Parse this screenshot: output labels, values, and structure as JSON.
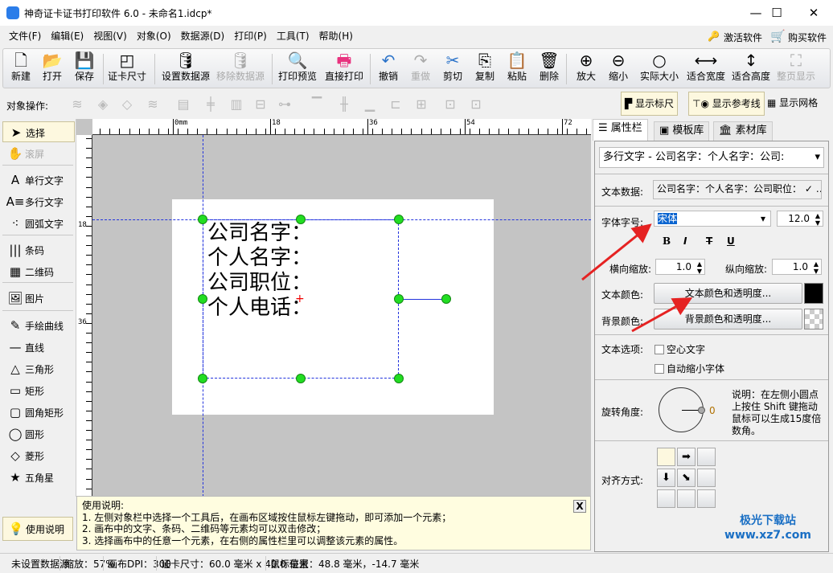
{
  "window": {
    "title": "神奇证卡证书打印软件 6.0 - 未命名1.idcp*",
    "minimize": "—",
    "maximize": "☐",
    "close": "✕"
  },
  "menu": [
    "文件(F)",
    "编辑(E)",
    "视图(V)",
    "对象(O)",
    "数据源(D)",
    "打印(P)",
    "工具(T)",
    "帮助(H)"
  ],
  "menu_right": {
    "activate": "激活软件",
    "buy": "购买软件"
  },
  "toolbar": [
    {
      "label": "新建",
      "icon": "new-file-icon",
      "glyph": "🗋"
    },
    {
      "label": "打开",
      "icon": "open-icon",
      "glyph": "📂"
    },
    {
      "label": "保存",
      "icon": "save-icon",
      "glyph": "💾"
    },
    {
      "label": "证卡尺寸",
      "icon": "card-size-icon",
      "glyph": "◰"
    },
    {
      "label": "设置数据源",
      "icon": "database-icon",
      "glyph": "🛢"
    },
    {
      "label": "移除数据源",
      "icon": "database-remove-icon",
      "glyph": "🛢",
      "disabled": true
    },
    {
      "label": "打印预览",
      "icon": "print-preview-icon",
      "glyph": "🔍"
    },
    {
      "label": "直接打印",
      "icon": "printer-icon",
      "glyph": "🖶"
    },
    {
      "label": "撤销",
      "icon": "undo-icon",
      "glyph": "↶"
    },
    {
      "label": "重做",
      "icon": "redo-icon",
      "glyph": "↷",
      "disabled": true
    },
    {
      "label": "剪切",
      "icon": "scissors-icon",
      "glyph": "✂"
    },
    {
      "label": "复制",
      "icon": "copy-icon",
      "glyph": "⎘"
    },
    {
      "label": "粘贴",
      "icon": "paste-icon",
      "glyph": "📋"
    },
    {
      "label": "删除",
      "icon": "trash-icon",
      "glyph": "🗑"
    },
    {
      "label": "放大",
      "icon": "zoom-in-icon",
      "glyph": "⊕"
    },
    {
      "label": "缩小",
      "icon": "zoom-out-icon",
      "glyph": "⊖"
    },
    {
      "label": "实际大小",
      "icon": "actual-size-icon",
      "glyph": "○"
    },
    {
      "label": "适合宽度",
      "icon": "fit-width-icon",
      "glyph": "⟷"
    },
    {
      "label": "适合高度",
      "icon": "fit-height-icon",
      "glyph": "↕"
    },
    {
      "label": "整页显示",
      "icon": "fit-page-icon",
      "glyph": "⛶",
      "disabled": true
    }
  ],
  "ops": {
    "label": "对象操作:",
    "show_ruler": "显示标尺",
    "show_guides": "显示参考线",
    "show_grid": "显示网格"
  },
  "tools": [
    {
      "label": "选择",
      "glyph": "➤",
      "icon": "pointer-icon"
    },
    {
      "label": "滚屏",
      "glyph": "✋",
      "icon": "hand-icon",
      "disabled": true
    },
    {
      "label": "单行文字",
      "glyph": "A",
      "icon": "single-line-text-icon"
    },
    {
      "label": "多行文字",
      "glyph": "A≡",
      "icon": "multi-line-text-icon"
    },
    {
      "label": "圆弧文字",
      "glyph": "⁖",
      "icon": "arc-text-icon"
    },
    {
      "label": "条码",
      "glyph": "|||",
      "icon": "barcode-icon"
    },
    {
      "label": "二维码",
      "glyph": "▦",
      "icon": "qrcode-icon"
    },
    {
      "label": "图片",
      "glyph": "🖼",
      "icon": "image-icon"
    },
    {
      "label": "手绘曲线",
      "glyph": "✎",
      "icon": "pen-icon"
    },
    {
      "label": "直线",
      "glyph": "—",
      "icon": "line-icon"
    },
    {
      "label": "三角形",
      "glyph": "△",
      "icon": "triangle-icon"
    },
    {
      "label": "矩形",
      "glyph": "▭",
      "icon": "rectangle-icon"
    },
    {
      "label": "圆角矩形",
      "glyph": "▢",
      "icon": "rounded-rect-icon"
    },
    {
      "label": "圆形",
      "glyph": "◯",
      "icon": "circle-icon"
    },
    {
      "label": "菱形",
      "glyph": "◇",
      "icon": "diamond-icon"
    },
    {
      "label": "五角星",
      "glyph": "★",
      "icon": "star-icon"
    }
  ],
  "help_button": "使用说明",
  "ruler": {
    "top": [
      "0mm",
      "18",
      "36",
      "54",
      "72"
    ],
    "left": [
      "0",
      "18",
      "36"
    ]
  },
  "card_lines": [
    "公司名字：",
    "个人名字：",
    "公司职位：",
    "个人电话："
  ],
  "panel": {
    "tabs": [
      "属性栏",
      "模板库",
      "素材库"
    ],
    "object_select": "多行文字 - 公司名字：个人名字：公司:",
    "text_data_label": "文本数据:",
    "text_data": "公司名字：个人名字：公司职位：",
    "font_label": "字体字号:",
    "font": "宋体",
    "font_size": "12.0",
    "style_buttons": [
      "B",
      "I",
      "T",
      "U"
    ],
    "hscale_label": "横向缩放:",
    "hscale": "1.0",
    "vscale_label": "纵向缩放:",
    "vscale": "1.0",
    "text_color_label": "文本颜色:",
    "text_color_btn": "文本颜色和透明度...",
    "text_color": "#000000",
    "bg_color_label": "背景颜色:",
    "bg_color_btn": "背景颜色和透明度...",
    "text_opts_label": "文本选项:",
    "hollow": "空心文字",
    "autoshrink": "自动缩小字体",
    "rotate_label": "旋转角度:",
    "rotate_value": "0",
    "rotate_note": [
      "说明：在左侧小圆点",
      "上按住 Shift 键拖动",
      "鼠标可以生成15度倍",
      "数角。"
    ],
    "align_label": "对齐方式:"
  },
  "help": {
    "title": "使用说明:",
    "lines": [
      "1. 左侧对象栏中选择一个工具后，在画布区域按住鼠标左键拖动，即可添加一个元素；",
      "2. 画布中的文字、条码、二维码等元素均可以双击修改；",
      "3. 选择画布中的任意一个元素，在右侧的属性栏里可以调整该元素的属性。"
    ],
    "close": "X"
  },
  "status": {
    "datasource": "未设置数据源",
    "zoom": "缩放：57%",
    "dpi": "画布DPI：300",
    "card_size": "证卡尺寸：60.0 毫米 x 40.0 毫米",
    "mouse": "鼠标位置：48.8 毫米，-14.7 毫米"
  },
  "watermark": "极光下载站 www.xz7.com"
}
